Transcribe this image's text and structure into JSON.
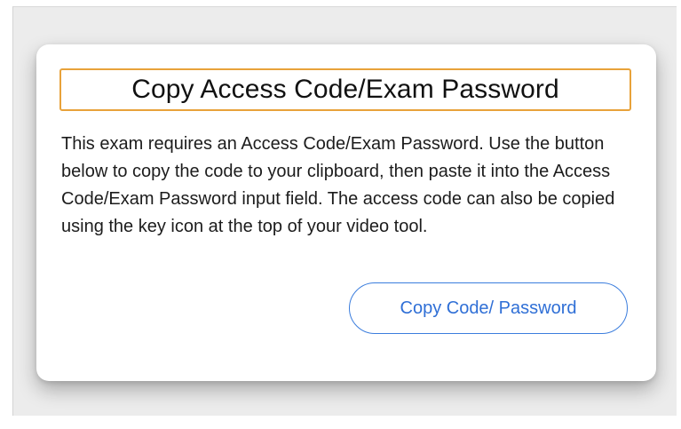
{
  "dialog": {
    "title": "Copy Access Code/Exam Password",
    "message": "This exam requires an Access Code/Exam Password. Use the button below to copy the code to your clipboard, then paste it into the Access Code/Exam Password input field. The access code can also be copied using the key icon at the top of your video tool.",
    "copy_button_label": "Copy Code/ Password"
  },
  "colors": {
    "title_border": "#e8a23a",
    "button_accent": "#3b7ddd",
    "backdrop": "#ececec"
  }
}
